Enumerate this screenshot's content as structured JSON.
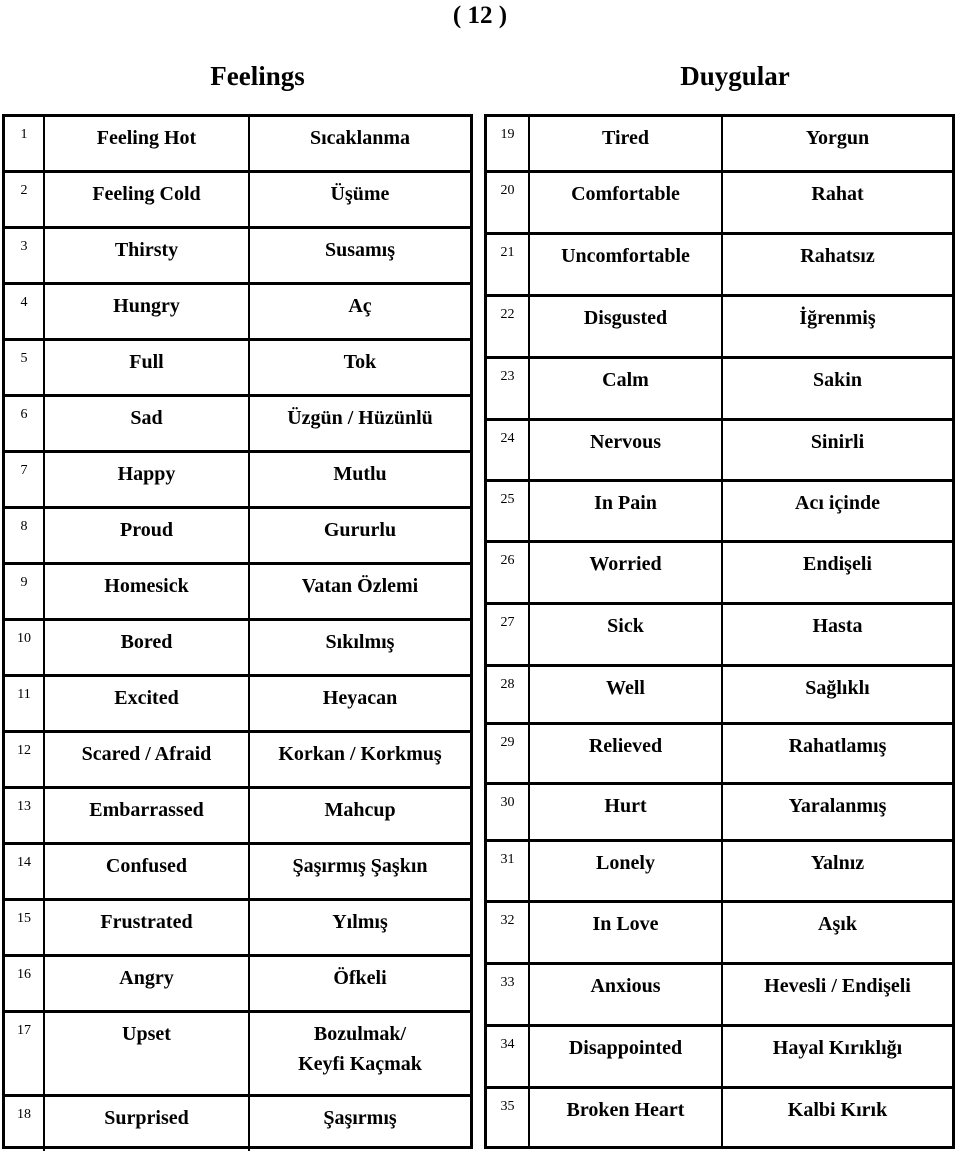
{
  "page_number": "( 12 )",
  "headings": {
    "left": "Feelings",
    "right": "Duygular"
  },
  "tables": {
    "left": [
      {
        "num": "1",
        "en": "Feeling Hot",
        "tr": "Sıcaklanma"
      },
      {
        "num": "2",
        "en": "Feeling Cold",
        "tr": "Üşüme"
      },
      {
        "num": "3",
        "en": "Thirsty",
        "tr": "Susamış"
      },
      {
        "num": "4",
        "en": "Hungry",
        "tr": "Aç"
      },
      {
        "num": "5",
        "en": "Full",
        "tr": "Tok"
      },
      {
        "num": "6",
        "en": "Sad",
        "tr": "Üzgün /  Hüzünlü"
      },
      {
        "num": "7",
        "en": "Happy",
        "tr": "Mutlu"
      },
      {
        "num": "8",
        "en": "Proud",
        "tr": "Gururlu"
      },
      {
        "num": "9",
        "en": "Homesick",
        "tr": "Vatan Özlemi"
      },
      {
        "num": "10",
        "en": "Bored",
        "tr": "Sıkılmış"
      },
      {
        "num": "11",
        "en": "Excited",
        "tr": "Heyacan"
      },
      {
        "num": "12",
        "en": "Scared / Afraid",
        "tr": "Korkan / Korkmuş"
      },
      {
        "num": "13",
        "en": "Embarrassed",
        "tr": "Mahcup"
      },
      {
        "num": "14",
        "en": "Confused",
        "tr": "Şaşırmış Şaşkın"
      },
      {
        "num": "15",
        "en": "Frustrated",
        "tr": "Yılmış"
      },
      {
        "num": "16",
        "en": "Angry",
        "tr": "Öfkeli"
      },
      {
        "num": "17",
        "en": "Upset",
        "tr": "Bozulmak/\nKeyfi Kaçmak"
      },
      {
        "num": "18",
        "en": "Surprised",
        "tr": "Şaşırmış"
      }
    ],
    "right": [
      {
        "num": "19",
        "en": "Tired",
        "tr": "Yorgun"
      },
      {
        "num": "20",
        "en": "Comfortable",
        "tr": "Rahat"
      },
      {
        "num": "21",
        "en": "Uncomfortable",
        "tr": "Rahatsız"
      },
      {
        "num": "22",
        "en": "Disgusted",
        "tr": "İğrenmiş"
      },
      {
        "num": "23",
        "en": "Calm",
        "tr": "Sakin"
      },
      {
        "num": "24",
        "en": "Nervous",
        "tr": "Sinirli"
      },
      {
        "num": "25",
        "en": "In Pain",
        "tr": "Acı içinde"
      },
      {
        "num": "26",
        "en": "Worried",
        "tr": "Endişeli"
      },
      {
        "num": "27",
        "en": "Sick",
        "tr": "Hasta"
      },
      {
        "num": "28",
        "en": "Well",
        "tr": "Sağlıklı"
      },
      {
        "num": "29",
        "en": "Relieved",
        "tr": "Rahatlamış"
      },
      {
        "num": "30",
        "en": "Hurt",
        "tr": "Yaralanmış"
      },
      {
        "num": "31",
        "en": "Lonely",
        "tr": "Yalnız"
      },
      {
        "num": "32",
        "en": "In Love",
        "tr": "Aşık"
      },
      {
        "num": "33",
        "en": "Anxious",
        "tr": "Hevesli /  Endişeli"
      },
      {
        "num": "34",
        "en": "Disappointed",
        "tr": "Hayal Kırıklığı"
      },
      {
        "num": "35",
        "en": "Broken Heart",
        "tr": "Kalbi Kırık"
      }
    ]
  }
}
